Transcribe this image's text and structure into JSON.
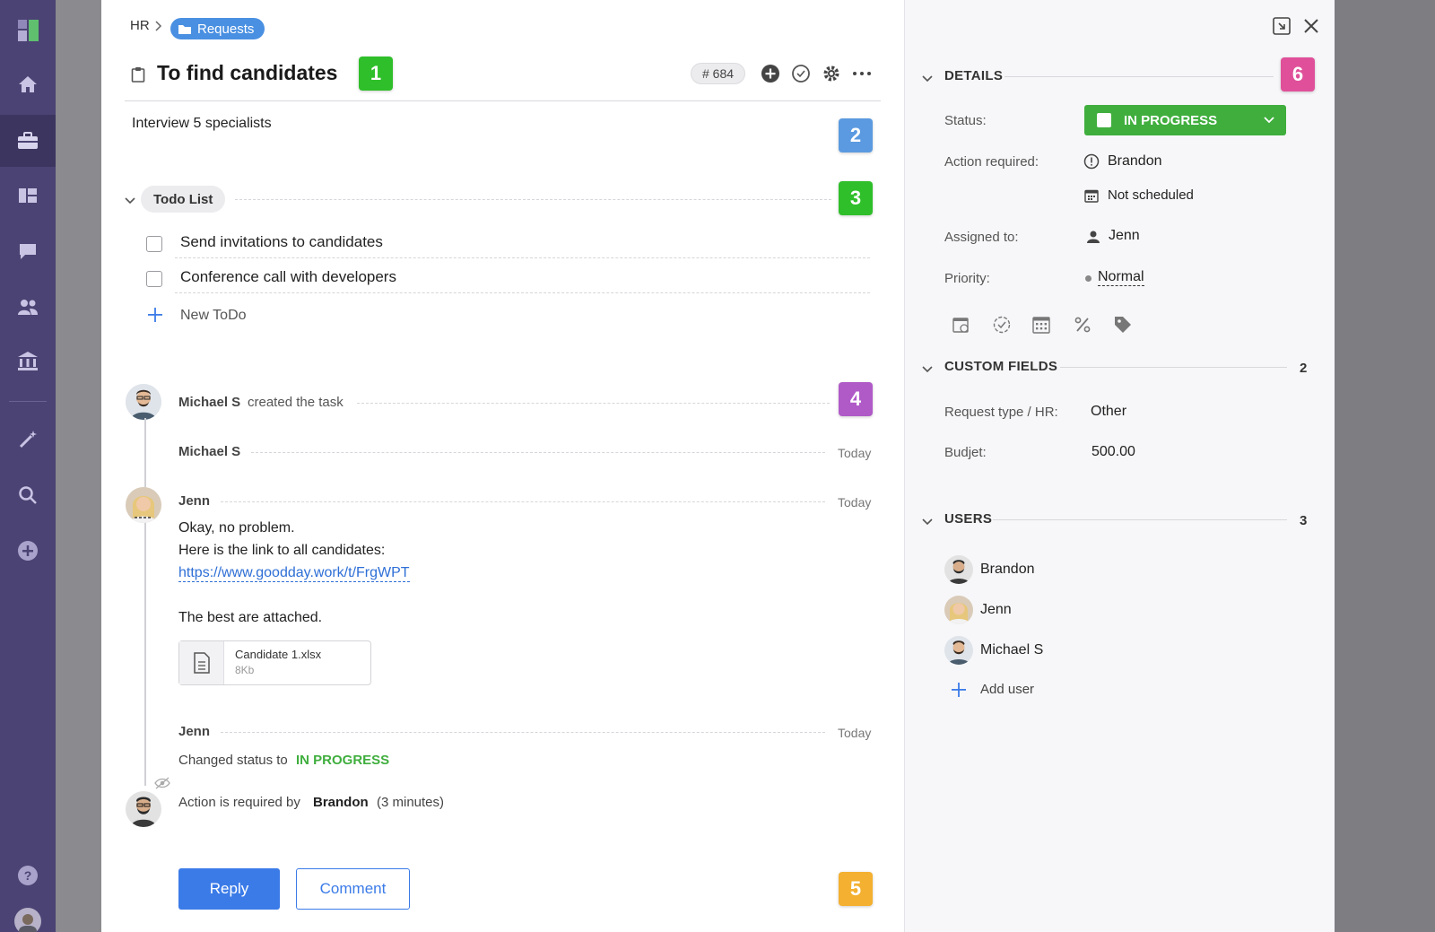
{
  "breadcrumb": {
    "parent": "HR",
    "current": "Requests"
  },
  "task": {
    "title": "To find candidates",
    "number": "# 684",
    "description": "Interview 5 specialists"
  },
  "badges": [
    "1",
    "2",
    "3",
    "4",
    "5",
    "6"
  ],
  "todo": {
    "header": "Todo List",
    "items": [
      "Send invitations to candidates",
      "Conference call with developers"
    ],
    "new_label": "New ToDo"
  },
  "activity": {
    "created_user": "Michael S",
    "created_text": "created the task",
    "entries": [
      {
        "user": "Michael S",
        "time": "Today"
      },
      {
        "user": "Jenn",
        "time": "Today"
      },
      {
        "user": "Jenn",
        "time": "Today"
      }
    ],
    "message_line1": "Okay, no problem.",
    "message_line2": "Here is the link to all candidates:",
    "message_link": "https://www.goodday.work/t/FrgWPT",
    "message_line3": "The best are attached.",
    "file_name": "Candidate 1.xlsx",
    "file_size": "8Kb",
    "status_change_prefix": "Changed status to",
    "status_change_value": "IN PROGRESS",
    "action_prefix": "Action is required by",
    "action_user": "Brandon",
    "action_duration": "(3 minutes)"
  },
  "buttons": {
    "reply": "Reply",
    "comment": "Comment"
  },
  "details": {
    "title": "DETAILS",
    "status_label": "Status:",
    "status_value": "IN PROGRESS",
    "action_label": "Action required:",
    "action_value": "Brandon",
    "schedule_value": "Not scheduled",
    "assigned_label": "Assigned to:",
    "assigned_value": "Jenn",
    "priority_label": "Priority:",
    "priority_value": "Normal"
  },
  "custom_fields": {
    "title": "CUSTOM FIELDS",
    "count": "2",
    "request_label": "Request type / HR:",
    "request_value": "Other",
    "budget_label": "Budjet:",
    "budget_value": "500.00"
  },
  "users": {
    "title": "USERS",
    "count": "3",
    "list": [
      "Brandon",
      "Jenn",
      "Michael S"
    ],
    "add_label": "Add user"
  },
  "colors": {
    "nav": "#4b4373",
    "accent_blue": "#3b7be8",
    "status_green": "#3fae3d",
    "badge_green": "#2fbf2a",
    "badge_blue": "#5b9ae0",
    "badge_purple": "#b05ac8",
    "badge_orange": "#f4b030",
    "badge_pink": "#e0509a"
  }
}
